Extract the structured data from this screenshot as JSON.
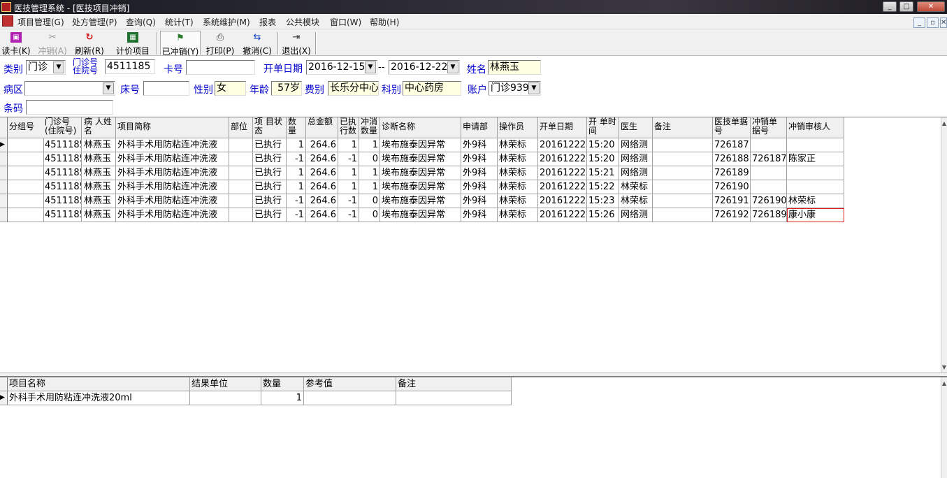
{
  "window": {
    "title": "医技管理系统 - [医技项目冲销]",
    "min": "_",
    "max": "□",
    "close": "✕"
  },
  "menu": [
    "项目管理(G)",
    "处方管理(P)",
    "查询(Q)",
    "统计(T)",
    "系统维护(M)",
    "报表",
    "公共模块",
    "窗口(W)",
    "帮助(H)"
  ],
  "toolbar": {
    "read_card": "读卡(K)",
    "write_off": "冲销(A)",
    "refresh": "刷新(R)",
    "pricing": "计价项目",
    "written_off": "已冲销(Y)",
    "print": "打印(P)",
    "undo": "撤消(C)",
    "exit": "退出(X)"
  },
  "form": {
    "category_label": "类别",
    "category_value": "门诊",
    "outpatient_label_1": "门诊号",
    "outpatient_label_2": "住院号",
    "outpatient_value": "4511185",
    "card_label": "卡号",
    "card_value": "",
    "date_label": "开单日期",
    "date_from": "2016-12-15",
    "date_sep": "--",
    "date_to": "2016-12-22",
    "name_label": "姓名",
    "name_value": "林燕玉",
    "ward_label": "病区",
    "ward_value": "",
    "bed_label": "床号",
    "bed_value": "",
    "sex_label": "性别",
    "sex_value": "女",
    "age_label": "年龄",
    "age_value": "57岁",
    "fee_label": "费别",
    "fee_value": "长乐分中心",
    "dept_label": "科别",
    "dept_value": "中心药房",
    "account_label": "账户",
    "account_value": "门诊939",
    "barcode_label": "条码",
    "barcode_value": ""
  },
  "main_grid": {
    "headers": [
      "分组号",
      "门诊号(住院号)",
      "病 人姓 名",
      "项目简称",
      "部位",
      "项 目状 态",
      "数量",
      "总金额",
      "已执行数",
      "冲消数量",
      "诊断名称",
      "申请部门",
      "操作员",
      "开单日期",
      "开 单时 间",
      "医生",
      "备注",
      "医技单据号",
      "冲销单据号",
      "冲销审核人"
    ],
    "rows": [
      [
        "",
        "4511185",
        "林燕玉",
        "外科手术用防粘连冲洗液",
        "",
        "已执行",
        "1",
        "264.6",
        "1",
        "1",
        "埃布施泰因异常",
        "外9科",
        "林荣标",
        "20161222",
        "15:20",
        "网络测",
        "",
        "726187",
        "",
        ""
      ],
      [
        "",
        "4511185",
        "林燕玉",
        "外科手术用防粘连冲洗液",
        "",
        "已执行",
        "-1",
        "264.6",
        "-1",
        "0",
        "埃布施泰因异常",
        "外9科",
        "林荣标",
        "20161222",
        "15:20",
        "网络测",
        "",
        "726188",
        "726187",
        "陈家正"
      ],
      [
        "",
        "4511185",
        "林燕玉",
        "外科手术用防粘连冲洗液",
        "",
        "已执行",
        "1",
        "264.6",
        "1",
        "1",
        "埃布施泰因异常",
        "外9科",
        "林荣标",
        "20161222",
        "15:21",
        "网络测",
        "",
        "726189",
        "",
        ""
      ],
      [
        "",
        "4511185",
        "林燕玉",
        "外科手术用防粘连冲洗液",
        "",
        "已执行",
        "1",
        "264.6",
        "1",
        "1",
        "埃布施泰因异常",
        "外9科",
        "林荣标",
        "20161222",
        "15:22",
        "林荣标",
        "",
        "726190",
        "",
        ""
      ],
      [
        "",
        "4511185",
        "林燕玉",
        "外科手术用防粘连冲洗液",
        "",
        "已执行",
        "-1",
        "264.6",
        "-1",
        "0",
        "埃布施泰因异常",
        "外9科",
        "林荣标",
        "20161222",
        "15:23",
        "林荣标",
        "",
        "726191",
        "726190",
        "林荣标"
      ],
      [
        "",
        "4511185",
        "林燕玉",
        "外科手术用防粘连冲洗液",
        "",
        "已执行",
        "-1",
        "264.6",
        "-1",
        "0",
        "埃布施泰因异常",
        "外9科",
        "林荣标",
        "20161222",
        "15:26",
        "网络测",
        "",
        "726192",
        "726189",
        "康小康"
      ]
    ]
  },
  "detail_grid": {
    "headers": [
      "项目名称",
      "结果单位",
      "数量",
      "参考值",
      "备注"
    ],
    "rows": [
      [
        "外科手术用防粘连冲洗液20ml",
        "",
        "1",
        "",
        ""
      ]
    ]
  }
}
